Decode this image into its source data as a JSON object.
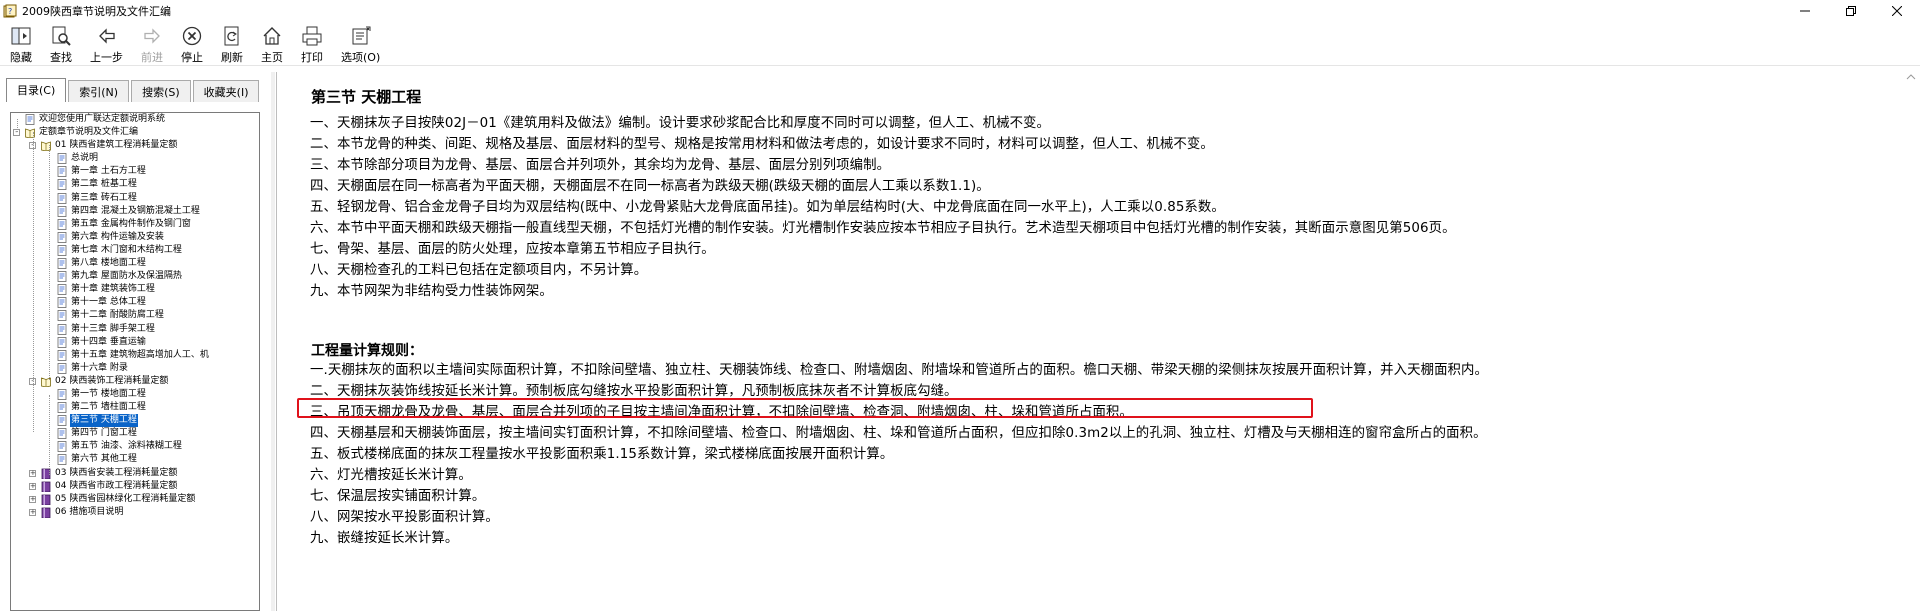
{
  "window": {
    "title": "2009陕西章节说明及文件汇编",
    "controls": [
      "minimize",
      "maximize",
      "close"
    ]
  },
  "toolbar": [
    {
      "label": "隐藏",
      "icon": "hide-icon",
      "enabled": true
    },
    {
      "label": "查找",
      "icon": "find-icon",
      "enabled": true
    },
    {
      "label": "上一步",
      "icon": "back-arrow-icon",
      "enabled": true
    },
    {
      "label": "前进",
      "icon": "forward-arrow-icon",
      "enabled": false
    },
    {
      "label": "停止",
      "icon": "stop-icon",
      "enabled": true
    },
    {
      "label": "刷新",
      "icon": "refresh-icon",
      "enabled": true
    },
    {
      "label": "主页",
      "icon": "home-icon",
      "enabled": true
    },
    {
      "label": "打印",
      "icon": "print-icon",
      "enabled": true
    },
    {
      "label": "选项(O)",
      "icon": "options-icon",
      "enabled": true
    }
  ],
  "tabs": [
    {
      "label": "目录(C)",
      "active": true
    },
    {
      "label": "索引(N)",
      "active": false
    },
    {
      "label": "搜索(S)",
      "active": false
    },
    {
      "label": "收藏夹(I)",
      "active": false
    }
  ],
  "tree": [
    {
      "label": "欢迎您使用广联达定额说明系统",
      "level": 1,
      "type": "page",
      "expander": ""
    },
    {
      "label": "定额章节说明及文件汇编",
      "level": 1,
      "type": "book-open",
      "expander": "-"
    },
    {
      "label": "01 陕西省建筑工程消耗量定额",
      "level": 2,
      "type": "book-open",
      "expander": "-"
    },
    {
      "label": "总说明",
      "level": 3,
      "type": "page",
      "expander": ""
    },
    {
      "label": "第一章 土石方工程",
      "level": 3,
      "type": "page",
      "expander": ""
    },
    {
      "label": "第二章 桩基工程",
      "level": 3,
      "type": "page",
      "expander": ""
    },
    {
      "label": "第三章 砖石工程",
      "level": 3,
      "type": "page",
      "expander": ""
    },
    {
      "label": "第四章 混凝土及钢筋混凝土工程",
      "level": 3,
      "type": "page",
      "expander": ""
    },
    {
      "label": "第五章 金属构件制作及钢门窗",
      "level": 3,
      "type": "page",
      "expander": ""
    },
    {
      "label": "第六章 构件运输及安装",
      "level": 3,
      "type": "page",
      "expander": ""
    },
    {
      "label": "第七章 木门窗和木结构工程",
      "level": 3,
      "type": "page",
      "expander": ""
    },
    {
      "label": "第八章 楼地面工程",
      "level": 3,
      "type": "page",
      "expander": ""
    },
    {
      "label": "第九章 屋面防水及保温隔热",
      "level": 3,
      "type": "page",
      "expander": ""
    },
    {
      "label": "第十章 建筑装饰工程",
      "level": 3,
      "type": "page",
      "expander": ""
    },
    {
      "label": "第十一章 总体工程",
      "level": 3,
      "type": "page",
      "expander": ""
    },
    {
      "label": "第十二章 耐酸防腐工程",
      "level": 3,
      "type": "page",
      "expander": ""
    },
    {
      "label": "第十三章 脚手架工程",
      "level": 3,
      "type": "page",
      "expander": ""
    },
    {
      "label": "第十四章 垂直运输",
      "level": 3,
      "type": "page",
      "expander": ""
    },
    {
      "label": "第十五章 建筑物超高增加人工、机",
      "level": 3,
      "type": "page",
      "expander": ""
    },
    {
      "label": "第十六章 附录",
      "level": 3,
      "type": "page",
      "expander": ""
    },
    {
      "label": "02 陕西装饰工程消耗量定额",
      "level": 2,
      "type": "book-open",
      "expander": "-"
    },
    {
      "label": "第一节 楼地面工程",
      "level": 3,
      "type": "page",
      "expander": ""
    },
    {
      "label": "第二节 墙柱面工程",
      "level": 3,
      "type": "page",
      "expander": ""
    },
    {
      "label": "第三节 天棚工程",
      "level": 3,
      "type": "page",
      "expander": "",
      "selected": true
    },
    {
      "label": "第四节 门窗工程",
      "level": 3,
      "type": "page",
      "expander": ""
    },
    {
      "label": "第五节 油漆、涂料裱糊工程",
      "level": 3,
      "type": "page",
      "expander": ""
    },
    {
      "label": "第六节 其他工程",
      "level": 3,
      "type": "page",
      "expander": ""
    },
    {
      "label": "03 陕西省安装工程消耗量定额",
      "level": 2,
      "type": "book-closed",
      "expander": "+"
    },
    {
      "label": "04 陕西省市政工程消耗量定额",
      "level": 2,
      "type": "book-closed",
      "expander": "+"
    },
    {
      "label": "05 陕西省园林绿化工程消耗量定额",
      "level": 2,
      "type": "book-closed",
      "expander": "+"
    },
    {
      "label": "06 措施项目说明",
      "level": 2,
      "type": "book-closed",
      "expander": "+"
    }
  ],
  "content": {
    "title": "第三节 天棚工程",
    "notes": [
      "一、天棚抹灰子目按陕02J－01《建筑用料及做法》编制。设计要求砂浆配合比和厚度不同时可以调整，但人工、机械不变。",
      "二、本节龙骨的种类、间距、规格及基层、面层材料的型号、规格是按常用材料和做法考虑的，如设计要求不同时，材料可以调整，但人工、机械不变。",
      "三、本节除部分项目为龙骨、基层、面层合并列项外，其余均为龙骨、基层、面层分别列项编制。",
      "四、天棚面层在同一标高者为平面天棚，天棚面层不在同一标高者为跌级天棚(跌级天棚的面层人工乘以系数1.1)。",
      "五、轻钢龙骨、铝合金龙骨子目均为双层结构(既中、小龙骨紧贴大龙骨底面吊挂)。如为单层结构时(大、中龙骨底面在同一水平上)，人工乘以0.85系数。",
      "六、本节中平面天棚和跌级天棚指一般直线型天棚，不包括灯光槽的制作安装。灯光槽制作安装应按本节相应子目执行。艺术造型天棚项目中包括灯光槽的制作安装，其断面示意图见第506页。",
      "七、骨架、基层、面层的防火处理，应按本章第五节相应子目执行。",
      "八、天棚检查孔的工料已包括在定额项目内，不另计算。",
      "九、本节网架为非结构受力性装饰网架。"
    ],
    "rules_heading": "工程量计算规则：",
    "rules": [
      "一.天棚抹灰的面积以主墙间实际面积计算，不扣除间壁墙、独立柱、天棚装饰线、检查口、附墙烟囱、附墙垛和管道所占的面积。檐口天棚、带梁天棚的梁侧抹灰按展开面积计算，并入天棚面积内。",
      "二、天棚抹灰装饰线按延长米计算。预制板底勾缝按水平投影面积计算，凡预制板底抹灰者不计算板底勾缝。",
      "三、吊顶天棚龙骨及龙骨、基层、面层合并列项的子目按主墙间净面积计算，不扣除间壁墙、检查洞、附墙烟囱、柱、垛和管道所占面积。",
      "四、天棚基层和天棚装饰面层，按主墙间实钉面积计算，不扣除间壁墙、检查口、附墙烟囱、柱、垛和管道所占面积，但应扣除0.3m2以上的孔洞、独立柱、灯槽及与天棚相连的窗帘盒所占的面积。",
      "五、板式楼梯底面的抹灰工程量按水平投影面积乘1.15系数计算，梁式楼梯底面按展开面积计算。",
      "六、灯光槽按延长米计算。",
      "七、保温层按实铺面积计算。",
      "八、网架按水平投影面积计算。",
      "九、嵌缝按延长米计算。"
    ],
    "highlighted_rule_index": 2,
    "highlight_color": "#e0121b"
  }
}
